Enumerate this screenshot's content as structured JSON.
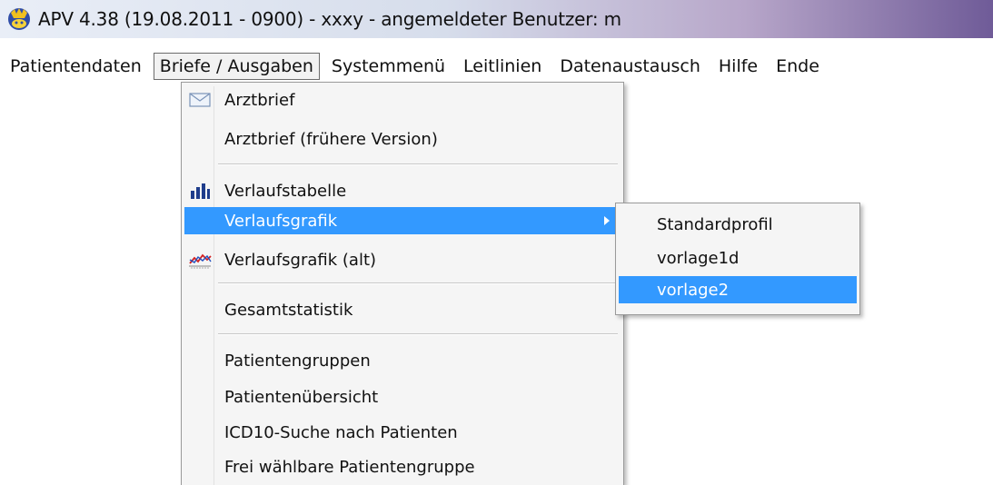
{
  "window": {
    "title": "APV 4.38 (19.08.2011 - 0900) - xxxy - angemeldeter Benutzer: m",
    "icon": "app-logo-icon"
  },
  "menubar": {
    "items": [
      {
        "label": "Patientendaten"
      },
      {
        "label": "Briefe / Ausgaben",
        "open": true
      },
      {
        "label": "Systemmenü"
      },
      {
        "label": "Leitlinien"
      },
      {
        "label": "Datenaustausch"
      },
      {
        "label": "Hilfe"
      },
      {
        "label": "Ende"
      }
    ]
  },
  "dropdown": {
    "items": [
      {
        "label": "Arztbrief",
        "icon": "envelope-icon"
      },
      {
        "label": "Arztbrief (frühere Version)"
      },
      {
        "label": "Verlaufstabelle",
        "icon": "bar-chart-icon"
      },
      {
        "label": "Verlaufsgrafik",
        "has_submenu": true,
        "highlighted": true
      },
      {
        "label": "Verlaufsgrafik (alt)",
        "icon": "line-graph-icon"
      },
      {
        "label": "Gesamtstatistik"
      },
      {
        "label": "Patientengruppen"
      },
      {
        "label": "Patientenübersicht"
      },
      {
        "label": "ICD10-Suche nach Patienten"
      },
      {
        "label": "Frei wählbare Patientengruppe"
      }
    ]
  },
  "submenu": {
    "items": [
      {
        "label": "Standardprofil"
      },
      {
        "label": "vorlage1d"
      },
      {
        "label": "vorlage2",
        "highlighted": true
      }
    ]
  },
  "colors": {
    "highlight": "#3399ff",
    "menu_background": "#f5f5f5"
  }
}
